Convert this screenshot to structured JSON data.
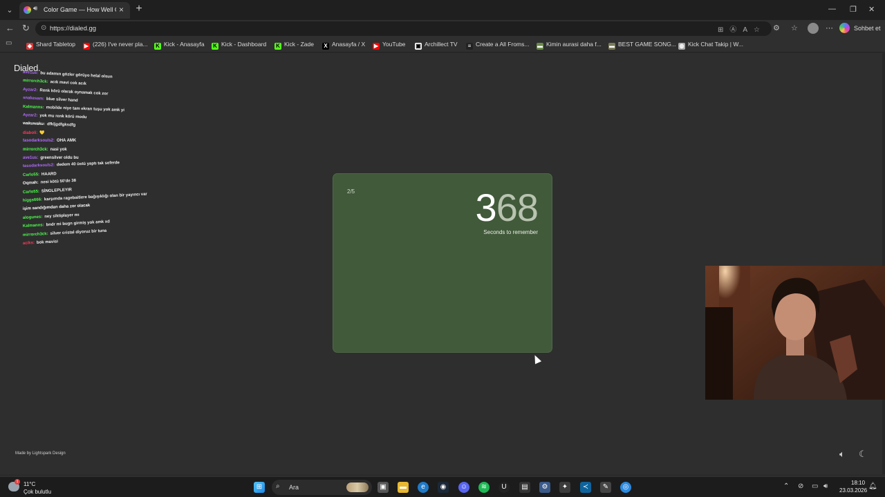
{
  "browser": {
    "tab_title": "Color Game — How Well Can",
    "url": "https://dialed.gg",
    "copilot_label": "Sohbet et",
    "bookmarks": [
      {
        "label": "Shard Tabletop",
        "icon": "shard-icon",
        "color": "#d63b3b"
      },
      {
        "label": "(226) I've never pla...",
        "icon": "youtube-icon",
        "color": "#ff0000"
      },
      {
        "label": "Kick - Anasayfa",
        "icon": "kick-icon",
        "color": "#53fc18"
      },
      {
        "label": "Kick - Dashboard",
        "icon": "kick-icon",
        "color": "#53fc18"
      },
      {
        "label": "Kick - Zade",
        "icon": "kick-icon",
        "color": "#53fc18"
      },
      {
        "label": "Anasayfa / X",
        "icon": "x-icon",
        "color": "#000000"
      },
      {
        "label": "YouTube",
        "icon": "youtube-icon",
        "color": "#ff0000"
      },
      {
        "label": "Archillect TV",
        "icon": "archillect-icon",
        "color": "#ffffff"
      },
      {
        "label": "Create a All Froms...",
        "icon": "tier-icon",
        "color": "#222222"
      },
      {
        "label": "Kimin aurasi daha f...",
        "icon": "page-icon",
        "color": "#6a8a4a"
      },
      {
        "label": "BEST GAME SONG...",
        "icon": "page-icon",
        "color": "#7a7a5a"
      },
      {
        "label": "Kick Chat Takip | W...",
        "icon": "globe-icon",
        "color": "#aaaaaa"
      }
    ]
  },
  "page": {
    "logo": "Dialed.",
    "round": "2/5",
    "timer_lead": "3",
    "timer_rest": "68",
    "timer_caption": "Seconds to remember",
    "card_color": "#415a3a",
    "footer": "Made by Lightspark Design"
  },
  "chat": [
    {
      "user": "ave1us:",
      "msg": "bu adamın gözler görüyo helal olsun",
      "color": "#b36bff"
    },
    {
      "user": "mirrorch3ck:",
      "msg": "acık mavi cok acık",
      "color": "#4cff4c"
    },
    {
      "user": "Ayzar2:",
      "msg": "Renk körü olarak oynamak cok zor",
      "color": "#b36bff"
    },
    {
      "user": "snakesam:",
      "msg": "blue silver hand",
      "color": "#b36bff"
    },
    {
      "user": "Kalmanns:",
      "msg": "mobilde niye tam ekran tuşu yok amk yi",
      "color": "#4cff4c"
    },
    {
      "user": "Ayzar2:",
      "msg": "yok mu renk körü modu",
      "color": "#b36bff"
    },
    {
      "user": "wakuwaku:",
      "msg": "dfkljgdfgksdfg",
      "color": "#ffffff"
    },
    {
      "user": "diaboli:",
      "msg": "💛",
      "color": "#ff3b5c"
    },
    {
      "user": "tasodarksouls2:",
      "msg": "OHA AMK",
      "color": "#b36bff"
    },
    {
      "user": "mirrorch3ck:",
      "msg": "nasi yok",
      "color": "#4cff4c"
    },
    {
      "user": "ave1us:",
      "msg": "greensilver oldu bu",
      "color": "#b36bff"
    },
    {
      "user": "tasodarksouls2:",
      "msg": "dedem 40 üstü yaptı tak seferde",
      "color": "#b36bff"
    },
    {
      "user": "Carlo55:",
      "msg": "HAARD",
      "color": "#4cff4c"
    },
    {
      "user": "Oqmah:",
      "msg": "nesi kötü 50'de 38",
      "color": "#ffffff"
    },
    {
      "user": "Carlo55:",
      "msg": "SİNGLEPLEYIR",
      "color": "#4cff4c"
    },
    {
      "user": "higgs666:",
      "msg": "karşımda ragebaitlere bağışıklığı olan bir yayıncı var",
      "color": "#4cff4c"
    },
    {
      "user": "işim sandığımdan daha zor olacak",
      "msg": "",
      "color": "#ffffff"
    },
    {
      "user": "alogunes:",
      "msg": "ney siktiplayer mı",
      "color": "#4cff4c"
    },
    {
      "user": "Kalmanns:",
      "msg": "bndr mi bugn girmiş yok amk xd",
      "color": "#4cff4c"
    },
    {
      "user": "mirrorch3ck:",
      "msg": "silver cristal diyoruz bir tuna",
      "color": "#4cff4c"
    },
    {
      "user": "aciks:",
      "msg": "bok mavisi",
      "color": "#ff3b5c"
    }
  ],
  "taskbar": {
    "weather_temp": "11°C",
    "weather_desc": "Çok bulutlu",
    "weather_badge": "1",
    "search_placeholder": "Ara",
    "time": "18:10",
    "date": "23.03.2026"
  }
}
